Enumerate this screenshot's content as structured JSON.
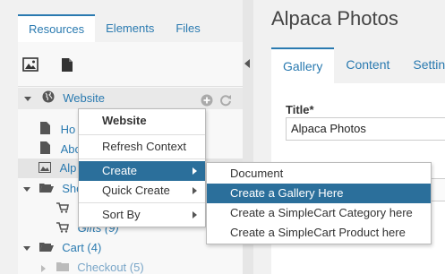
{
  "left_tabs": [
    "Resources",
    "Elements",
    "Files"
  ],
  "tree": {
    "website": "Website",
    "items": [
      {
        "label": "Ho",
        "type": "page"
      },
      {
        "label": "Abo",
        "type": "page"
      },
      {
        "label": "Alp",
        "type": "image"
      },
      {
        "label": "Sho",
        "type": "folder"
      },
      {
        "label": "Gifts (9)",
        "type": "cart"
      },
      {
        "label": "Cart (4)",
        "type": "folder"
      },
      {
        "label": "Checkout (5)",
        "type": "folder"
      }
    ]
  },
  "context_menu": {
    "header": "Website",
    "items": [
      "Refresh Context",
      "Create",
      "Quick Create",
      "Sort By"
    ]
  },
  "submenu": {
    "items": [
      "Document",
      "Create a Gallery Here",
      "Create a SimpleCart Category here",
      "Create a SimpleCart Product here"
    ]
  },
  "right": {
    "page_title": "Alpaca Photos",
    "tabs": [
      "Gallery",
      "Content",
      "Settin"
    ],
    "title_label": "Title*",
    "title_value": "Alpaca Photos"
  },
  "colors": {
    "accent": "#2a7ab0",
    "selection": "#2b6f9b"
  }
}
